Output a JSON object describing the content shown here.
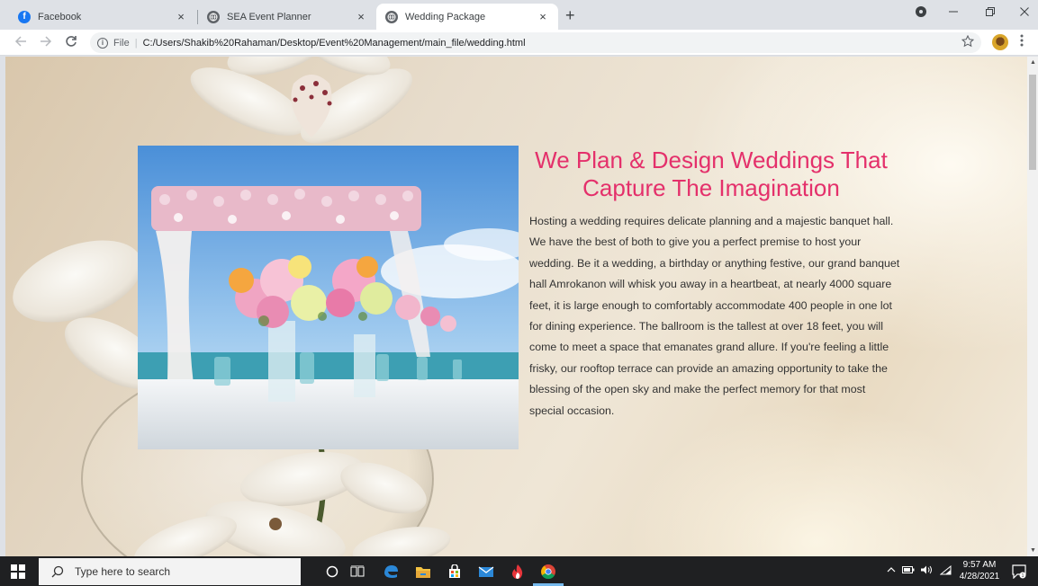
{
  "browser": {
    "tabs": [
      {
        "title": "Facebook",
        "icon": "facebook-icon",
        "active": false
      },
      {
        "title": "SEA Event Planner",
        "icon": "globe-icon",
        "active": false
      },
      {
        "title": "Wedding Package",
        "icon": "globe-icon",
        "active": true
      }
    ],
    "tab_close_glyph": "×",
    "new_tab_glyph": "+",
    "address": {
      "scheme_label": "File",
      "url": "C:/Users/Shakib%20Rahaman/Desktop/Event%20Management/main_file/wedding.html"
    }
  },
  "page": {
    "heading": "We Plan & Design Weddings That Capture The Imagination",
    "body": "Hosting a wedding requires delicate planning and a majestic banquet hall. We have the best of both to give you a perfect premise to host your wedding. Be it a wedding, a birthday or anything festive, our grand banquet hall Amrokanon will whisk you away in a heartbeat, at nearly 4000 square feet, it is large enough to comfortably accommodate 400 people in one lot for dining experience. The ballroom is the tallest at over 18 feet, you will come to meet a space that emanates grand allure. If you're feeling a little frisky, our rooftop terrace can provide an amazing opportunity to take the blessing of the open sky and make the perfect memory for that most special occasion.",
    "heading_color": "#e4306b"
  },
  "taskbar": {
    "search_placeholder": "Type here to search",
    "time": "9:57 AM",
    "date": "4/28/2021"
  },
  "colors": {
    "taskbar": "#1f2022",
    "tabstrip": "#dee1e6",
    "facebook": "#1877f2"
  }
}
